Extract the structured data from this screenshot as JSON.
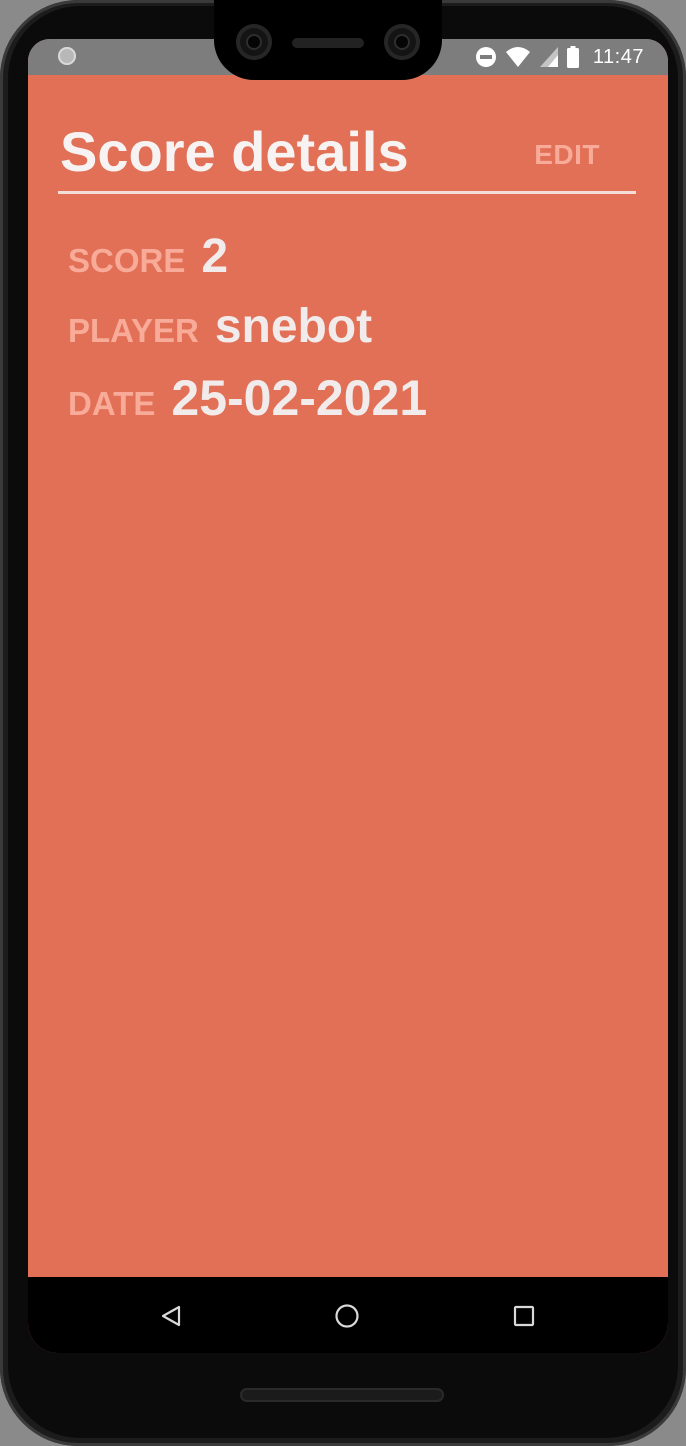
{
  "status_bar": {
    "time": "11:47",
    "icons": [
      "notification-dot-icon",
      "do-not-disturb-icon",
      "wifi-icon",
      "signal-icon",
      "battery-icon"
    ]
  },
  "header": {
    "title": "Score details",
    "edit_label": "EDIT"
  },
  "details": {
    "score_label": "SCORE",
    "score_value": "2",
    "player_label": "PLAYER",
    "player_value": "snebot",
    "date_label": "DATE",
    "date_value": "25-02-2021"
  },
  "nav_bar": {
    "icons": [
      "back-icon",
      "home-icon",
      "recents-icon"
    ]
  },
  "colors": {
    "background": "#e27056",
    "label": "#f8ab98",
    "value": "#f1eceb",
    "status_bar": "#7d7d7d"
  }
}
